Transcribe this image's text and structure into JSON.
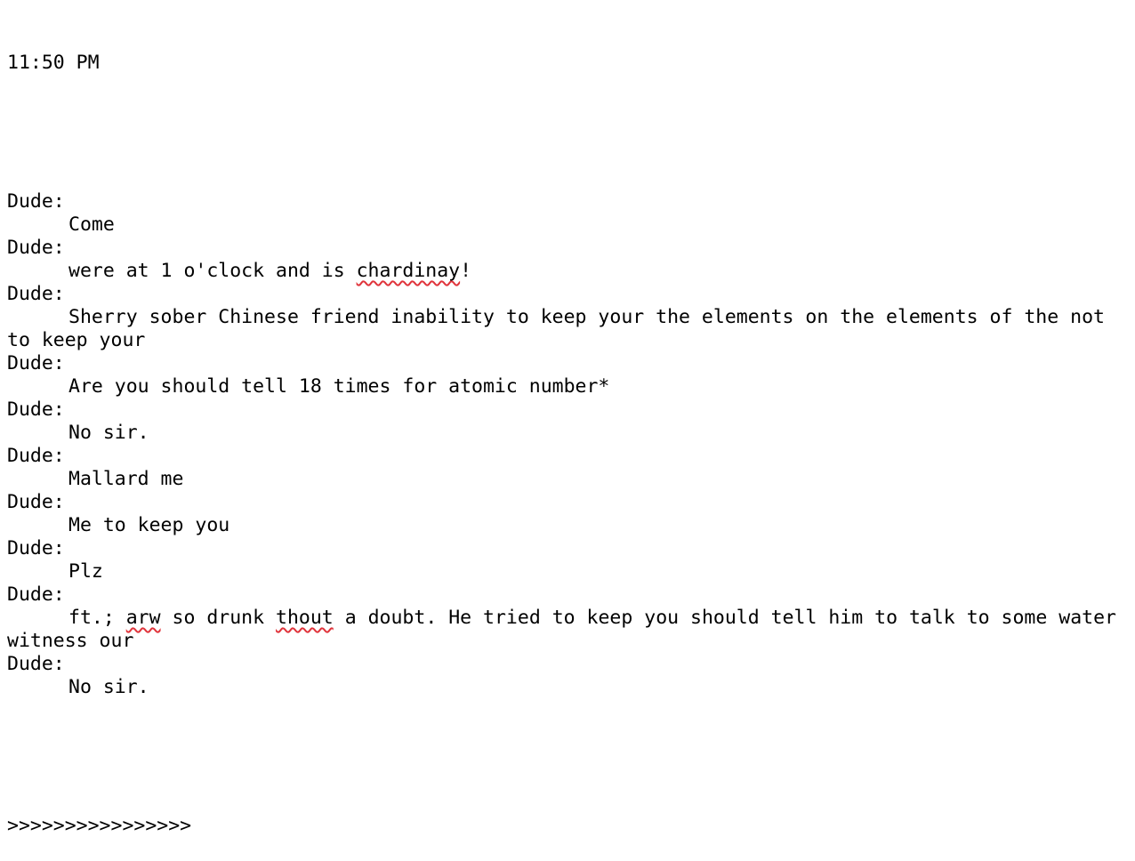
{
  "timestamp": "11:50 PM",
  "messages": [
    {
      "speaker": "Dude:",
      "segments": [
        {
          "text": "Come"
        }
      ]
    },
    {
      "speaker": "Dude:",
      "segments": [
        {
          "text": "were at 1 o'clock and is "
        },
        {
          "text": "chardinay",
          "misspelled": true
        },
        {
          "text": "!"
        }
      ]
    },
    {
      "speaker": "Dude:",
      "segments": [
        {
          "text": "Sherry sober Chinese friend inability to keep your the elements on the elements of the not to keep your"
        }
      ]
    },
    {
      "speaker": "Dude:",
      "segments": [
        {
          "text": "Are you should tell 18 times for atomic number*"
        }
      ]
    },
    {
      "speaker": "Dude:",
      "segments": [
        {
          "text": "No sir."
        }
      ]
    },
    {
      "speaker": "Dude:",
      "segments": [
        {
          "text": "Mallard me"
        }
      ]
    },
    {
      "speaker": "Dude:",
      "segments": [
        {
          "text": "Me to keep you"
        }
      ]
    },
    {
      "speaker": "Dude:",
      "segments": [
        {
          "text": "Plz"
        }
      ]
    },
    {
      "speaker": "Dude:",
      "segments": [
        {
          "text": "ft.; "
        },
        {
          "text": "arw",
          "misspelled": true
        },
        {
          "text": " so drunk "
        },
        {
          "text": "thout",
          "misspelled": true
        },
        {
          "text": " a doubt. He tried to keep you should tell him to talk to some water witness our"
        }
      ]
    },
    {
      "speaker": "Dude:",
      "segments": [
        {
          "text": "No sir."
        }
      ]
    }
  ],
  "footer": ">>>>>>>>>>>>>>>>",
  "colors": {
    "text": "#000000",
    "background": "#ffffff",
    "spellcheck_underline": "#e0343b"
  }
}
